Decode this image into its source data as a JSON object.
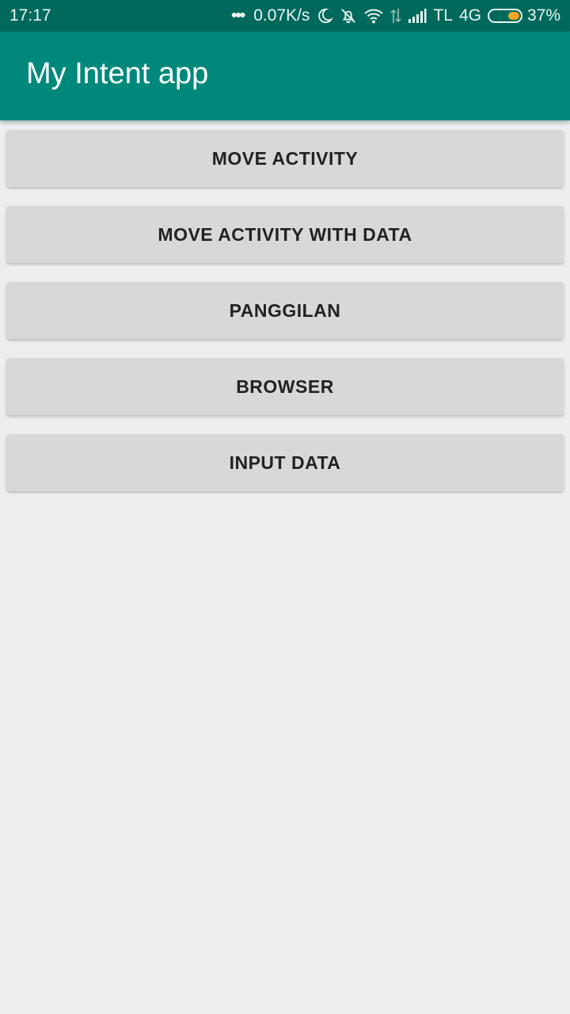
{
  "status_bar": {
    "time": "17:17",
    "network_speed": "0.07K/s",
    "carrier": "TL",
    "network_type": "4G",
    "battery_percent": "37%",
    "battery_level": 0.37,
    "icons": [
      "more-dots-icon",
      "moon-icon",
      "bell-muted-icon",
      "wifi-icon",
      "data-arrows-icon",
      "signal-icon",
      "battery-icon"
    ]
  },
  "app_bar": {
    "title": "My Intent app"
  },
  "buttons": [
    {
      "label": "MOVE ACTIVITY"
    },
    {
      "label": "MOVE ACTIVITY WITH DATA"
    },
    {
      "label": "PANGGILAN"
    },
    {
      "label": "BROWSER"
    },
    {
      "label": "INPUT DATA"
    }
  ],
  "colors": {
    "status_bar": "#00695c",
    "app_bar": "#00897b",
    "background": "#eeeeee",
    "button": "#d7d8d8",
    "battery_fill": "#f5a623"
  }
}
